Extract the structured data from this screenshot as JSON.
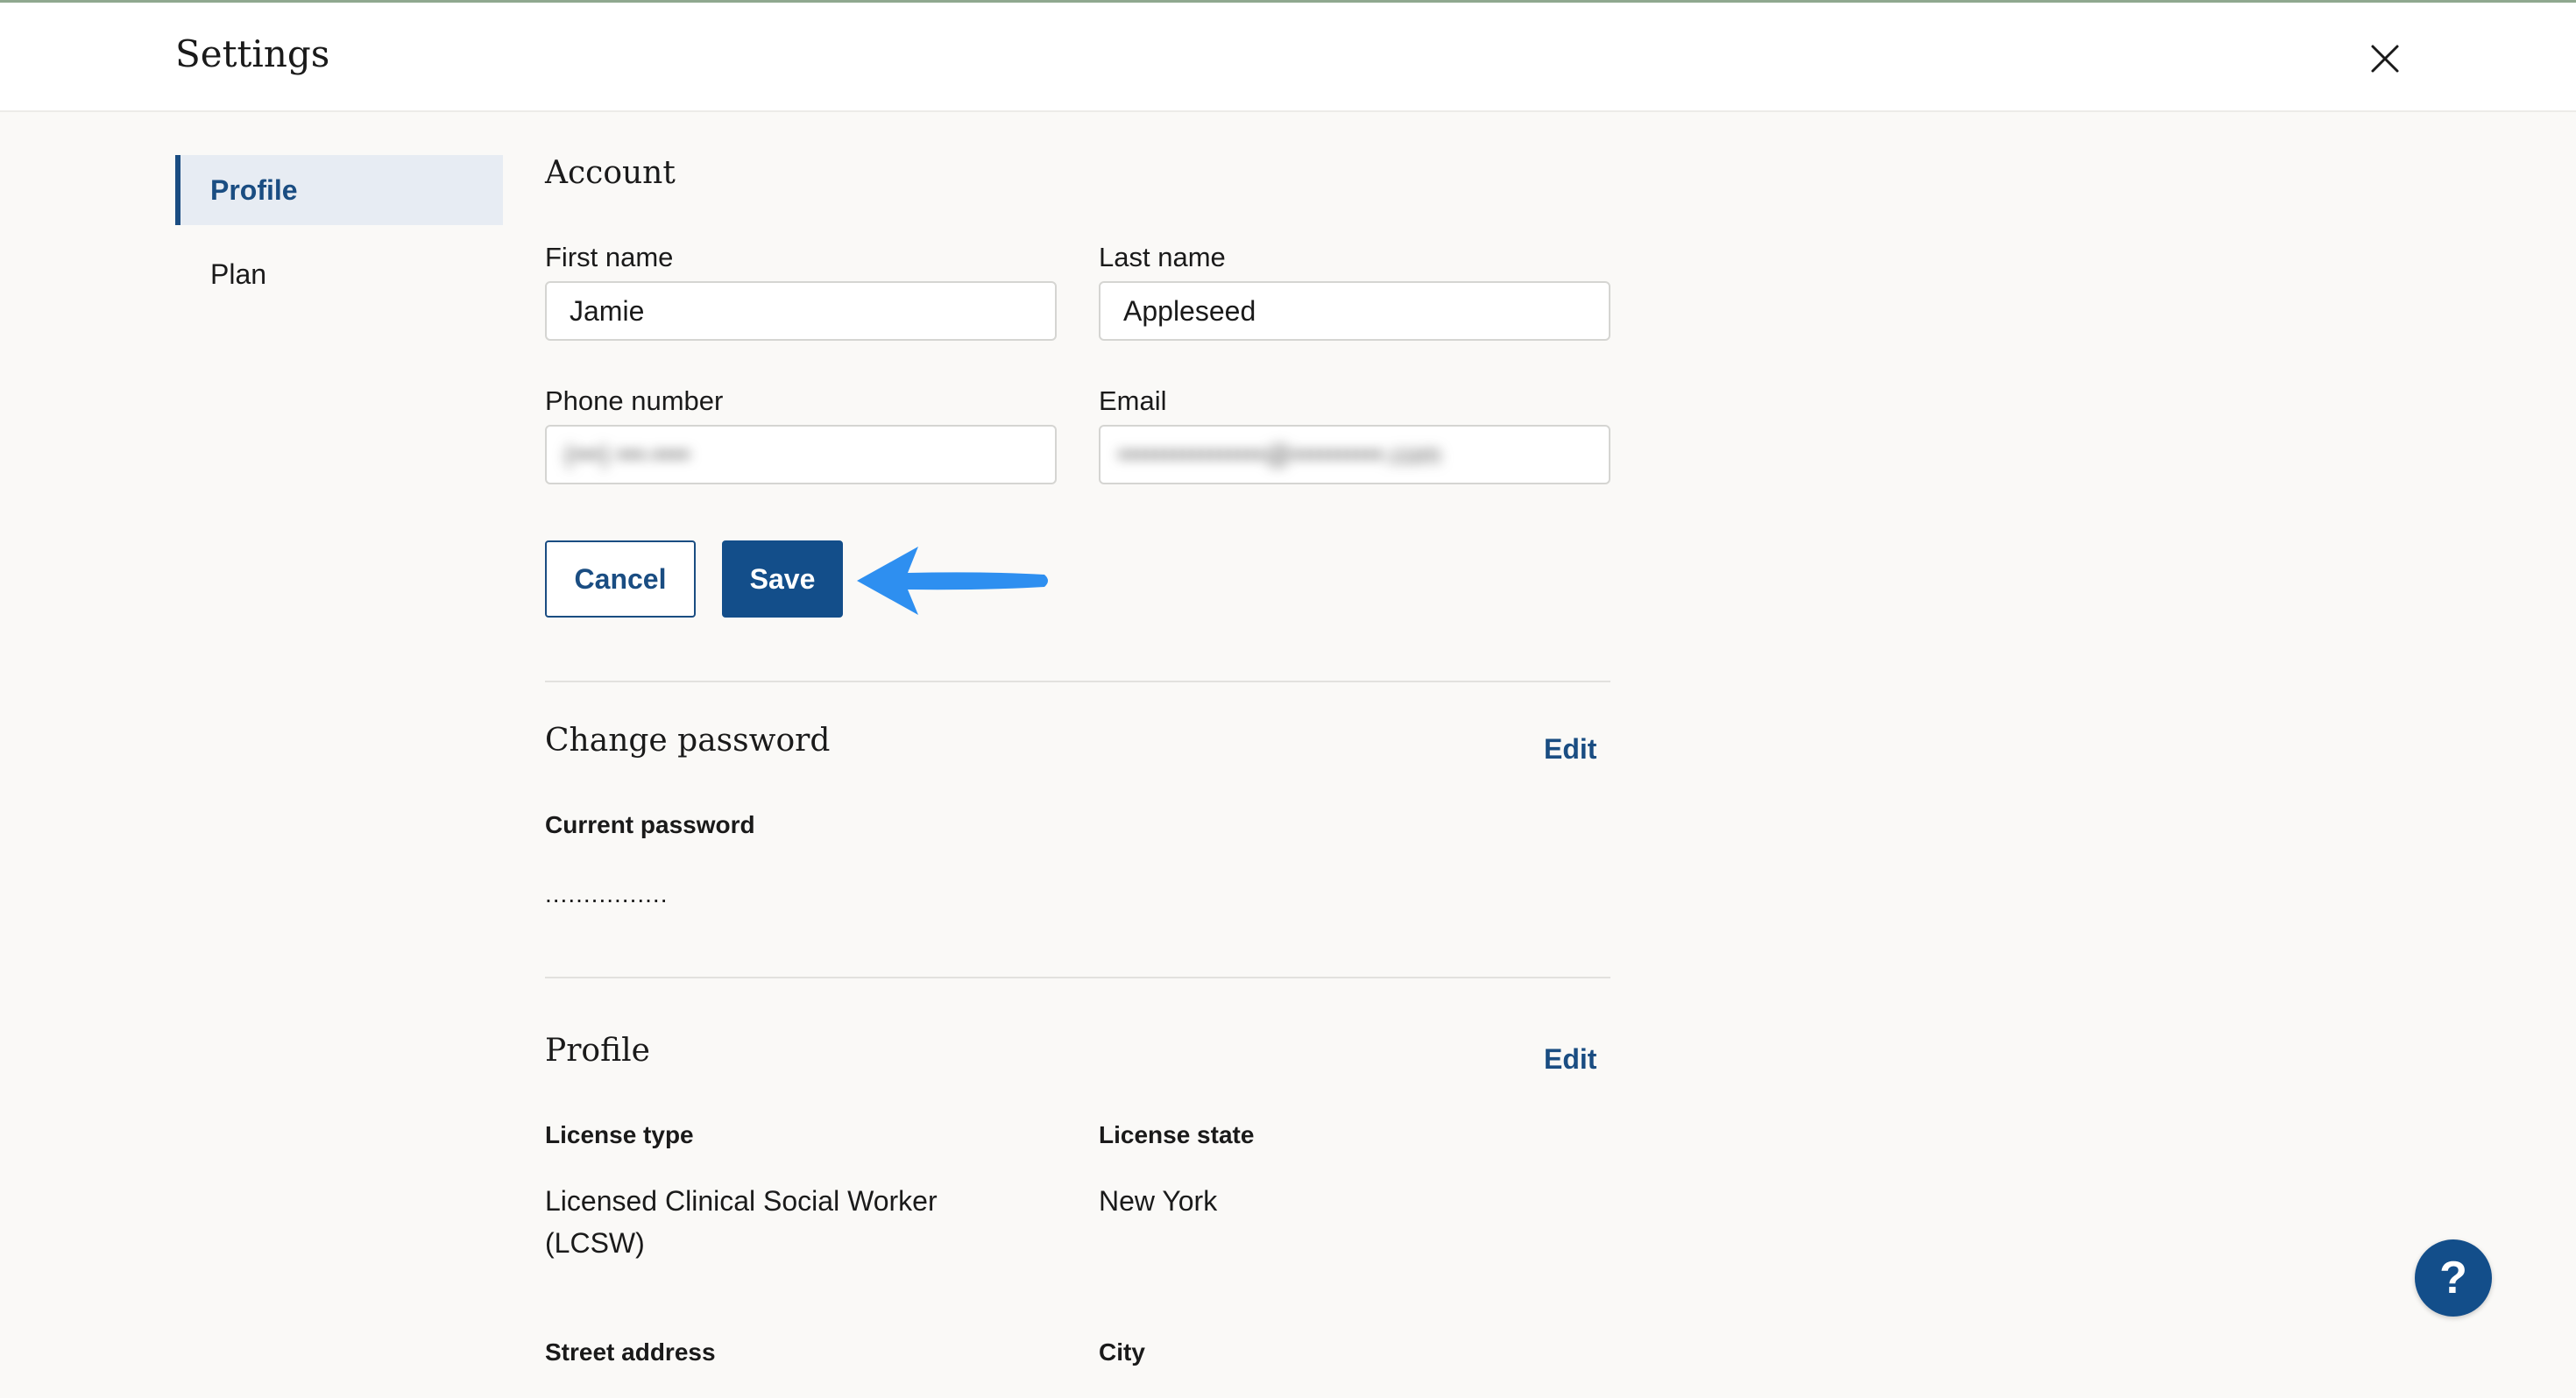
{
  "header": {
    "title": "Settings",
    "close_icon": "close-icon"
  },
  "sidebar": {
    "items": [
      {
        "label": "Profile",
        "active": true
      },
      {
        "label": "Plan",
        "active": false
      }
    ]
  },
  "account": {
    "title": "Account",
    "first_name": {
      "label": "First name",
      "value": "Jamie"
    },
    "last_name": {
      "label": "Last name",
      "value": "Appleseed"
    },
    "phone": {
      "label": "Phone number",
      "value": "(•••) •••-••••"
    },
    "email": {
      "label": "Email",
      "value": "••••••••••••••••@••••••••••.com"
    },
    "cancel_label": "Cancel",
    "save_label": "Save"
  },
  "change_password": {
    "title": "Change password",
    "edit_label": "Edit",
    "current_label": "Current password",
    "current_value": "................"
  },
  "profile": {
    "title": "Profile",
    "edit_label": "Edit",
    "license_type_label": "License type",
    "license_type_value": "Licensed Clinical Social Worker (LCSW)",
    "license_state_label": "License state",
    "license_state_value": "New York",
    "street_label": "Street address",
    "city_label": "City"
  },
  "help": {
    "label": "?"
  },
  "colors": {
    "accent": "#134e8a",
    "arrow": "#2e8ff0",
    "background": "#faf9f7"
  }
}
